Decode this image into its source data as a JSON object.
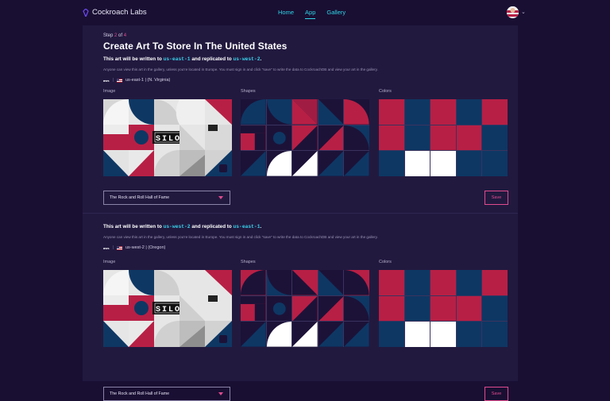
{
  "header": {
    "brand": "Cockroach Labs",
    "nav": [
      "Home",
      "App",
      "Gallery"
    ],
    "active_nav": "App"
  },
  "step": {
    "prefix": "Step",
    "current": "2",
    "of": "of",
    "total": "4"
  },
  "title": "Create Art To Store In The United States",
  "columns": {
    "image": "Image",
    "shapes": "Shapes",
    "colors": "Colors"
  },
  "description": "Anyone can view this art in the gallery, unless you're located in Europe. You must sign in and click \"save\" to write the data to CockroachDB and view your art in the gallery.",
  "sections": [
    {
      "write_prefix": "This art will be written to",
      "write_region": "us-east-1",
      "replicated_prefix": "and replicated to",
      "replicated_region": "us-west-2",
      "period": ".",
      "provider": "aws",
      "region_label": "us-east-1 | (N. Virginia)",
      "selected_image": "The Rock and Roll Hall of Fame",
      "save_label": "Save",
      "colors": [
        "#b81f45",
        "#0e3764",
        "#b81f45",
        "#0e3764",
        "#b81f45",
        "#b81f45",
        "#0e3764",
        "#b81f45",
        "#b81f45",
        "#0e3764",
        "#0e3764",
        "#ffffff",
        "#ffffff",
        "#0e3764",
        "#0e3764"
      ]
    },
    {
      "write_prefix": "This art will be written to",
      "write_region": "us-west-2",
      "replicated_prefix": "and replicated to",
      "replicated_region": "us-east-1",
      "period": ".",
      "provider": "aws",
      "region_label": "us-west-2 | (Oregon)",
      "selected_image": "The Rock and Roll Hall of Fame",
      "save_label": "Save",
      "colors": [
        "#b81f45",
        "#0e3764",
        "#b81f45",
        "#0e3764",
        "#b81f45",
        "#b81f45",
        "#0e3764",
        "#b81f45",
        "#b81f45",
        "#0e3764",
        "#0e3764",
        "#ffffff",
        "#ffffff",
        "#0e3764",
        "#0e3764"
      ]
    }
  ],
  "image_sign_text": "SILO",
  "palette": {
    "red": "#b81f45",
    "navy": "#0e3764",
    "dark": "#1c1238",
    "white": "#ffffff",
    "accent": "#e04b8e",
    "cyan": "#2fd4e6"
  }
}
